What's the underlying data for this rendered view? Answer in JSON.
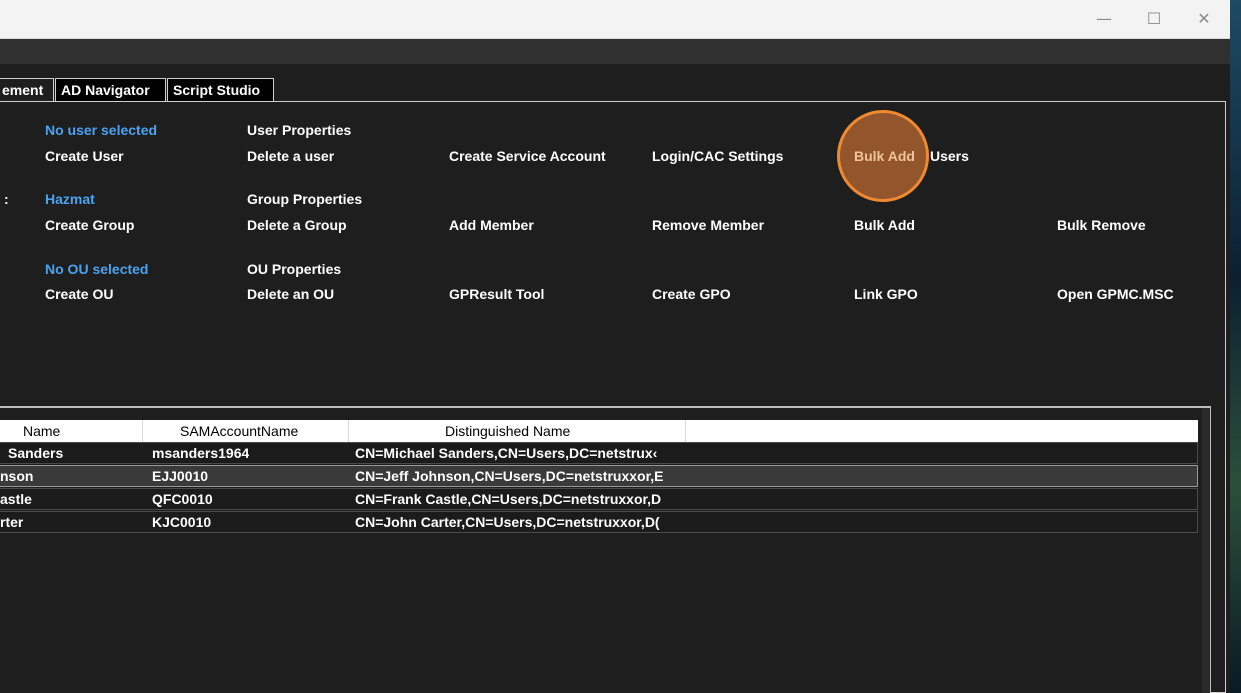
{
  "window": {
    "minimize_glyph": "—",
    "maximize_glyph": "☐",
    "close_glyph": "✕"
  },
  "tabs": [
    "ement",
    "AD Navigator",
    "Script Studio"
  ],
  "actions": {
    "users": {
      "status": "No user selected",
      "create": "Create User",
      "properties": "User Properties",
      "delete": "Delete a user",
      "service_account": "Create Service Account",
      "login_cac": "Login/CAC Settings",
      "bulk_add": "Bulk Add",
      "bulk_add_suffix": "Users"
    },
    "groups": {
      "side_mark": ":",
      "status": "Hazmat",
      "create": "Create Group",
      "properties": "Group Properties",
      "delete": "Delete a Group",
      "add_member": "Add Member",
      "remove_member": "Remove Member",
      "bulk_add": "Bulk Add",
      "bulk_remove": "Bulk Remove"
    },
    "ous": {
      "status": "No OU selected",
      "create": "Create OU",
      "properties": "OU Properties",
      "delete": "Delete an OU",
      "gpresult": "GPResult Tool",
      "create_gpo": "Create GPO",
      "link_gpo": "Link GPO",
      "open_gpmc": "Open GPMC.MSC"
    }
  },
  "colors": {
    "status_blue": "#4aa3f0",
    "highlight_ring": "#f08a30",
    "highlight_text": "#f2c49a"
  },
  "table": {
    "columns": [
      "Name",
      "SAMAccountName",
      "Distinguished Name"
    ],
    "rows": [
      {
        "name": "Sanders",
        "sam": "msanders1964",
        "dn": "CN=Michael Sanders,CN=Users,DC=netstrux‹",
        "selected": false
      },
      {
        "name": "nson",
        "sam": "EJJ0010",
        "dn": "CN=Jeff Johnson,CN=Users,DC=netstruxxor,E",
        "selected": true
      },
      {
        "name": "astle",
        "sam": "QFC0010",
        "dn": "CN=Frank Castle,CN=Users,DC=netstruxxor,D",
        "selected": false
      },
      {
        "name": "rter",
        "sam": "KJC0010",
        "dn": "CN=John Carter,CN=Users,DC=netstruxxor,D(",
        "selected": false
      }
    ]
  }
}
